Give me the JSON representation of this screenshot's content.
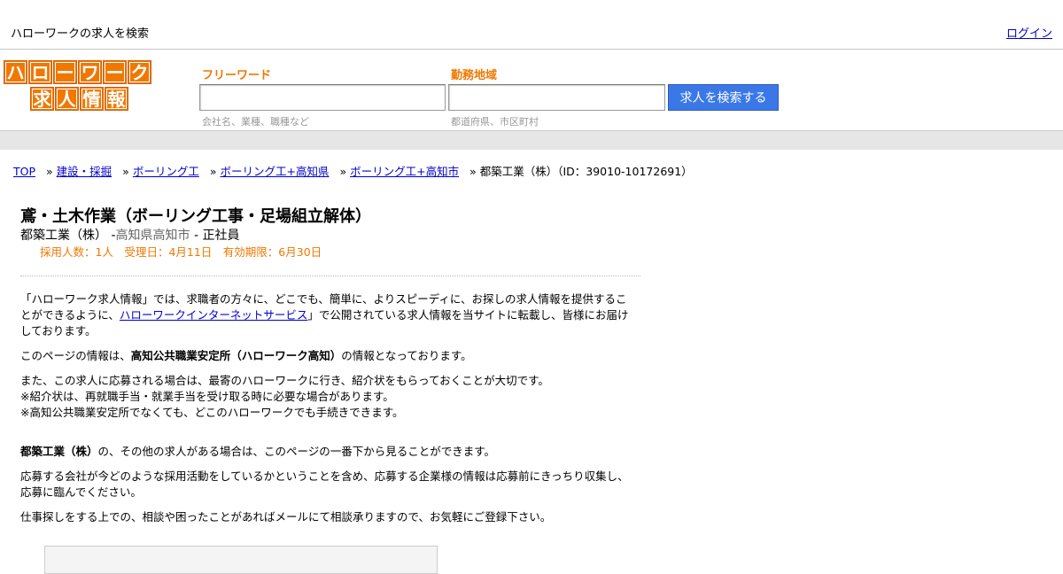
{
  "topbar": {
    "tagline": "ハローワークの求人を検索",
    "login": "ログイン"
  },
  "logo": {
    "row1": [
      "ハ",
      "ロ",
      "ー",
      "ワ",
      "ー",
      "ク"
    ],
    "row2": [
      "求",
      "人",
      "情",
      "報"
    ]
  },
  "search": {
    "freeword_label": "フリーワード",
    "freeword_value": "",
    "freeword_hint": "会社名、業種、職種など",
    "area_label": "勤務地域",
    "area_value": "",
    "area_hint": "都道府県、市区町村",
    "button": "求人を検索する"
  },
  "breadcrumb": {
    "items": [
      "TOP",
      "建設・採掘",
      "ボーリング工",
      "ボーリング工+高知県",
      "ボーリング工+高知市"
    ],
    "sep": "»",
    "current": "都築工業（株）（ID：39010-10172691）"
  },
  "job": {
    "title": "鳶・土木作業（ボーリング工事・足場組立解体）",
    "company": "都築工業（株）",
    "dash1": " -",
    "location": "高知県高知市",
    "dash2": " - ",
    "employment": "正社員",
    "meta": "採用人数：1人　受理日：4月11日　有効期限：6月30日"
  },
  "body": {
    "p1_a": "「ハローワーク求人情報」では、求職者の方々に、どこでも、簡単に、よりスピーディに、お探しの求人情報を提供することができるように、",
    "p1_link": "ハローワークインターネットサービス",
    "p1_b": "」で公開されている求人情報を当サイトに転載し、皆様にお届けしております。",
    "p2_a": "このページの情報は、",
    "p2_bold": "高知公共職業安定所（ハローワーク高知）",
    "p2_b": "の情報となっております。",
    "p3_l1": "また、この求人に応募される場合は、最寄のハローワークに行き、紹介状をもらっておくことが大切です。",
    "p3_l2": "※紹介状は、再就職手当・就業手当を受け取る時に必要な場合があります。",
    "p3_l3": "※高知公共職業安定所でなくても、どこのハローワークでも手続きできます。",
    "p4_bold": "都築工業（株）",
    "p4_b": "の、その他の求人がある場合は、このページの一番下から見ることができます。",
    "p5": "応募する会社が今どのような採用活動をしているかということを含め、応募する企業様の情報は応募前にきっちり収集し、応募に臨んでください。",
    "p6": "仕事探しをする上での、相談や困ったことがあればメールにて相談承りますので、お気軽にご登録下さい。"
  },
  "colors": {
    "accent": "#f07800",
    "button": "#3b78e7",
    "link": "#0000cc"
  }
}
